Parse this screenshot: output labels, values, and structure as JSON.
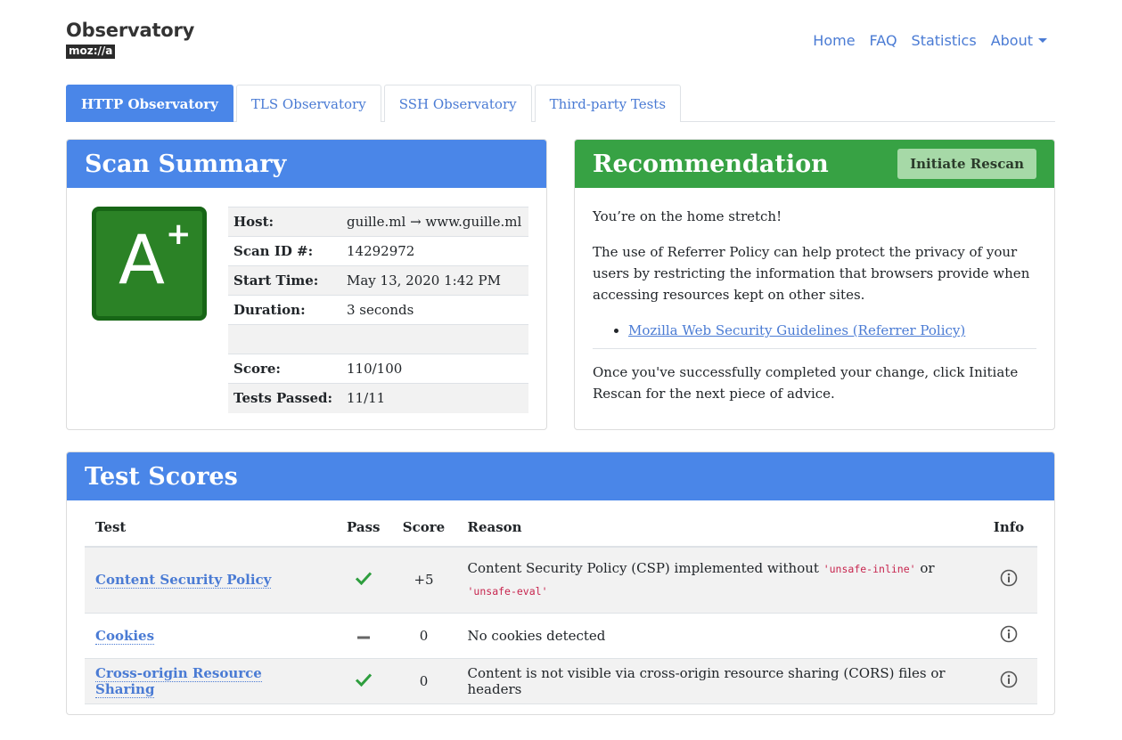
{
  "header": {
    "logo_title": "Observatory",
    "logo_badge": "moz://a",
    "nav": [
      "Home",
      "FAQ",
      "Statistics",
      "About"
    ]
  },
  "tabs": [
    "HTTP Observatory",
    "TLS Observatory",
    "SSH Observatory",
    "Third-party Tests"
  ],
  "scan_summary": {
    "title": "Scan Summary",
    "grade": "A",
    "grade_modifier": "+",
    "rows": [
      {
        "key": "Host:",
        "value": "guille.ml → www.guille.ml"
      },
      {
        "key": "Scan ID #:",
        "value": "14292972"
      },
      {
        "key": "Start Time:",
        "value": "May 13, 2020 1:42 PM"
      },
      {
        "key": "Duration:",
        "value": "3 seconds"
      },
      {
        "key": "",
        "value": ""
      },
      {
        "key": "Score:",
        "value": "110/100"
      },
      {
        "key": "Tests Passed:",
        "value": "11/11"
      }
    ]
  },
  "recommendation": {
    "title": "Recommendation",
    "button": "Initiate Rescan",
    "intro": "You’re on the home stretch!",
    "body": "The use of Referrer Policy can help protect the privacy of your users by restricting the information that browsers provide when accessing resources kept on other sites.",
    "link": "Mozilla Web Security Guidelines (Referrer Policy)",
    "footer": "Once you've successfully completed your change, click Initiate Rescan for the next piece of advice."
  },
  "test_scores": {
    "title": "Test Scores",
    "columns": [
      "Test",
      "Pass",
      "Score",
      "Reason",
      "Info"
    ],
    "rows": [
      {
        "test": "Content Security Policy",
        "pass": "check",
        "score": "+5",
        "reason_text": "Content Security Policy (CSP) implemented without ",
        "code1": "'unsafe-inline'",
        "mid": " or ",
        "code2": "'unsafe-eval'"
      },
      {
        "test": "Cookies",
        "pass": "dash",
        "score": "0",
        "reason_text": "No cookies detected"
      },
      {
        "test": "Cross-origin Resource Sharing",
        "pass": "check",
        "score": "0",
        "reason_text": "Content is not visible via cross-origin resource sharing (CORS) files or headers"
      }
    ]
  },
  "colors": {
    "accent_blue": "#4a86e8",
    "recommendation_green": "#37a244",
    "grade_green": "#2b8226",
    "pass_green": "#2e9e3e"
  }
}
